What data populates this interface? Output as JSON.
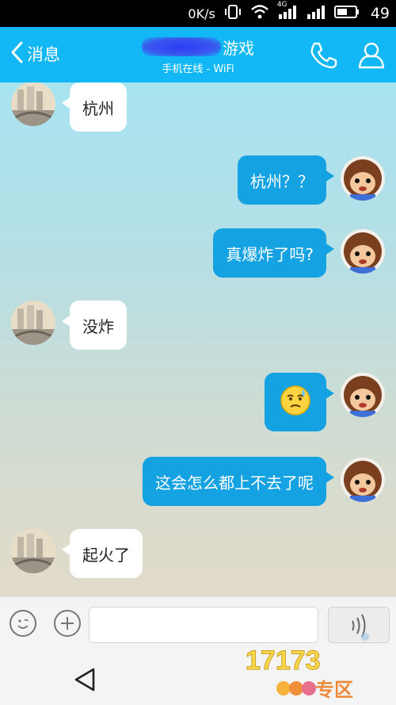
{
  "status_bar": {
    "speed": "0K/s",
    "network": "4G",
    "battery": "49"
  },
  "header": {
    "back_label": "消息",
    "title": "游戏",
    "subtitle": "手机在线 - WiFi",
    "color": "#12b7f5"
  },
  "messages": [
    {
      "side": "left",
      "text": "杭州"
    },
    {
      "side": "right",
      "text": "杭州？？"
    },
    {
      "side": "right",
      "text": "真爆炸了吗?"
    },
    {
      "side": "left",
      "text": "没炸"
    },
    {
      "side": "right",
      "emoji": "sweat-smile-emoji"
    },
    {
      "side": "right",
      "text": "这会怎么都上不去了呢"
    },
    {
      "side": "left",
      "text": "起火了"
    }
  ],
  "input": {
    "value": "",
    "placeholder": ""
  },
  "watermark": {
    "brand": "17173",
    "sub": "专区"
  }
}
